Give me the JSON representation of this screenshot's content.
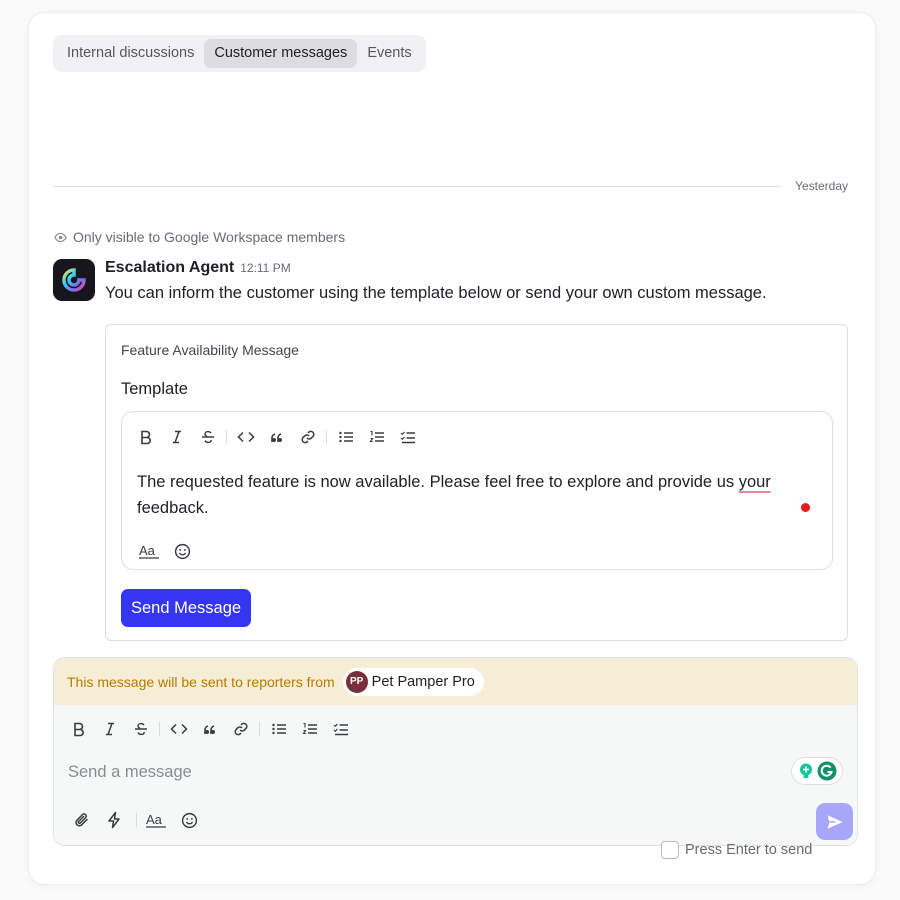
{
  "tabs": [
    {
      "label": "Internal discussions",
      "active": false
    },
    {
      "label": "Customer messages",
      "active": true
    },
    {
      "label": "Events",
      "active": false
    }
  ],
  "divider": {
    "label": "Yesterday"
  },
  "visibility_note": "Only visible to Google Workspace members",
  "agent_message": {
    "sender": "Escalation Agent",
    "time": "12:11 PM",
    "text": "You can inform the customer using the template below or send your own custom message."
  },
  "template_card": {
    "title": "Feature Availability Message",
    "section_label": "Template",
    "body_before": "The requested feature is now available. Please feel free to explore and provide us ",
    "body_underlined": "your",
    "body_after": " feedback.",
    "send_label": "Send Message"
  },
  "composer": {
    "banner_text": "This message will be sent to reporters from",
    "org_name": "Pet Pamper Pro",
    "org_initials": "PP",
    "placeholder": "Send a message"
  },
  "enter_to_send": {
    "label": "Press Enter to send",
    "checked": false
  },
  "colors": {
    "accent": "#3535f2",
    "send_disabled": "#a8a6f8",
    "banner_bg": "#f6edd6",
    "banner_text": "#b87a00"
  }
}
